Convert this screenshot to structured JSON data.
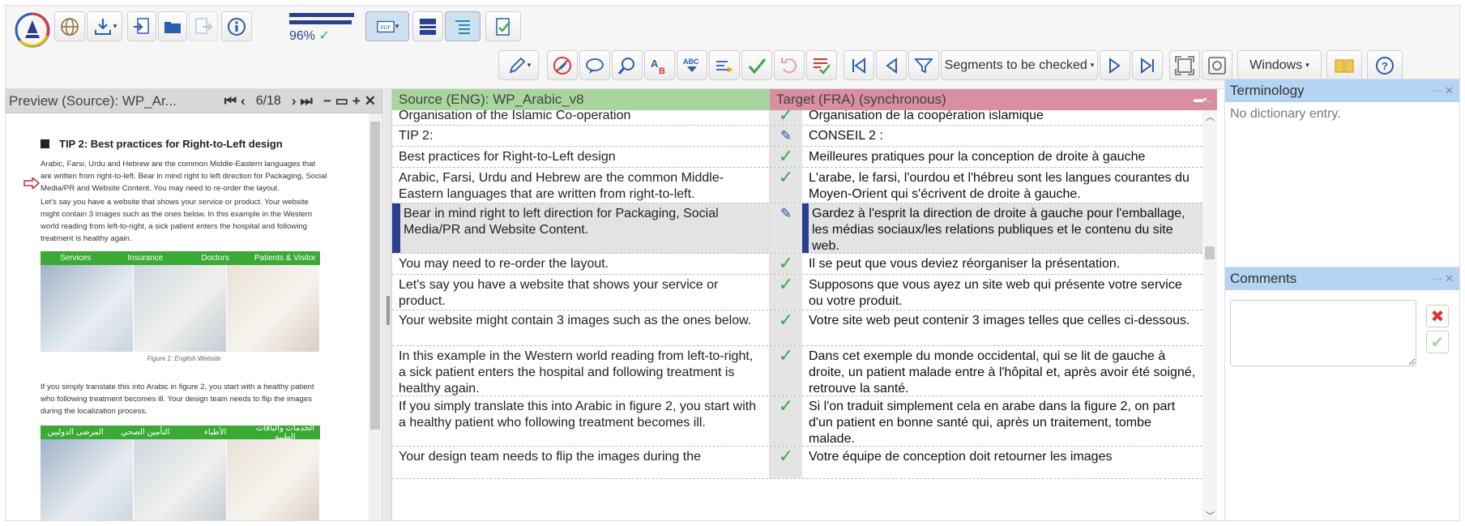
{
  "toolbar": {
    "progress_pct": "96%",
    "progress_value": 0.96,
    "segments_filter_label": "Segments to be checked",
    "windows_label": "Windows",
    "icons": [
      "logo-icon",
      "globe-icon",
      "download-icon",
      "import-icon",
      "folder-icon",
      "export-icon",
      "info-icon",
      "pdf-icon",
      "layout-horizontal-icon",
      "layout-list-icon",
      "check-document-icon",
      "pencil-icon",
      "no-edit-icon",
      "comment-icon",
      "search-icon",
      "spellcheck-icon",
      "abc-icon",
      "translate-icon",
      "confirm-icon",
      "undo-icon",
      "qa-icon",
      "first-icon",
      "prev-icon",
      "filter-icon",
      "next-icon",
      "last-icon",
      "fit-icon",
      "screenshot-icon",
      "book-icon",
      "help-icon"
    ]
  },
  "preview": {
    "title": "Preview (Source): WP_Ar...",
    "page": "6/18",
    "heading": "TIP 2: Best practices for Right-to-Left design",
    "para1": "Arabic, Farsi, Urdu and Hebrew are the common Middle-Eastern languages that are written from right-to-left. Bear in mind right to left direction for Packaging, Social Media/PR and Website Content. You may need to re-order the layout.",
    "para2": "Let's say you have a website that shows your service or product. Your website might contain 3 images such as the ones below. In this example in the Western world reading from left-to-right, a sick patient enters the hospital and following treatment is healthy again.",
    "fig1_tabs": [
      "Services",
      "Insurance",
      "Doctors",
      "Patients & Visitor"
    ],
    "fig1_caption": "Figure 1: English Website",
    "para3": "If you simply translate this into Arabic in figure 2, you start with a healthy patient who following treatment becomes ill. Your design team needs to flip the images during the localization process.",
    "fig2_tabs": [
      "المرضى الدوليين",
      "التأمين الصحي",
      "الأطباء",
      "الخدمات والباقات الطبية"
    ]
  },
  "grid": {
    "source_header": "Source (ENG): WP_Arabic_v8",
    "target_header": "Target (FRA) (synchronous)",
    "rows": [
      {
        "src": "Organisation of the Islamic Co-operation",
        "tgt": "Organisation de la coopération islamique",
        "status": "✓"
      },
      {
        "src": "TIP 2:",
        "tgt": "CONSEIL 2 :",
        "status": "✎"
      },
      {
        "src": "Best practices for Right-to-Left design",
        "tgt": "Meilleures pratiques pour la conception de droite à gauche",
        "status": "✓"
      },
      {
        "src": "Arabic, Farsi, Urdu and Hebrew are the common Middle-Eastern languages that are written from right-to-left.",
        "tgt": "L'arabe, le farsi, l'ourdou et l'hébreu sont les langues courantes du Moyen-Orient qui s'écrivent de droite à gauche.",
        "status": "✓"
      },
      {
        "src": "Bear in mind right to left direction for Packaging, Social Media/PR and Website Content.",
        "tgt": "Gardez à l'esprit la direction de droite à gauche pour l'emballage, les médias sociaux/les relations publiques et le contenu du site web.",
        "status": "✎"
      },
      {
        "src": "You may need to re-order the layout.",
        "tgt": "Il se peut que vous deviez réorganiser la présentation.",
        "status": "✓"
      },
      {
        "src": "Let's say you have a website that shows your service or product.",
        "tgt": "Supposons que vous ayez un site web qui présente votre service ou votre produit.",
        "status": "✓"
      },
      {
        "src": "Your website might contain 3 images such as the ones below.",
        "tgt": "Votre site web peut contenir 3 images telles que celles ci-dessous.",
        "status": "✓"
      },
      {
        "src": "In this example in the Western world reading from left-to-right, a sick patient enters the hospital and following treatment is healthy again.",
        "tgt": "Dans cet exemple du monde occidental, qui se lit de gauche à droite, un patient malade entre à l'hôpital et, après avoir été soigné, retrouve la santé.",
        "status": "✓"
      },
      {
        "src": "If you simply translate this into Arabic in figure 2, you start with a healthy patient who following treatment becomes ill.",
        "tgt": "Si l'on traduit simplement cela en arabe dans la figure 2, on part d'un patient en bonne santé qui, après un traitement, tombe malade.",
        "status": "✓"
      },
      {
        "src": "Your design team needs to flip the images during the",
        "tgt": "Votre équipe de conception doit retourner les images",
        "status": "✓"
      }
    ]
  },
  "terminology": {
    "title": "Terminology",
    "empty": "No dictionary entry."
  },
  "comments": {
    "title": "Comments"
  },
  "colors": {
    "accent": "#2a3f8f",
    "source_header": "#a9d6a0",
    "target_header": "#d98ea1",
    "panel_header": "#b5d3f2",
    "check": "#3aa84a"
  }
}
